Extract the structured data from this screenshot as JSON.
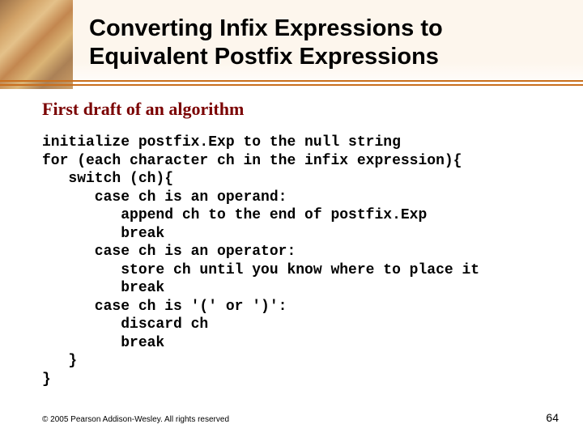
{
  "header": {
    "title_line1": "Converting Infix Expressions to",
    "title_line2": "Equivalent Postfix Expressions"
  },
  "subtitle": "First draft of an algorithm",
  "code": "initialize postfix.Exp to the null string\nfor (each character ch in the infix expression){\n   switch (ch){\n      case ch is an operand:\n         append ch to the end of postfix.Exp\n         break\n      case ch is an operator:\n         store ch until you know where to place it\n         break\n      case ch is '(' or ')':\n         discard ch\n         break\n   }\n}",
  "footer": {
    "copyright": "© 2005 Pearson Addison-Wesley. All rights reserved",
    "page": "64"
  }
}
